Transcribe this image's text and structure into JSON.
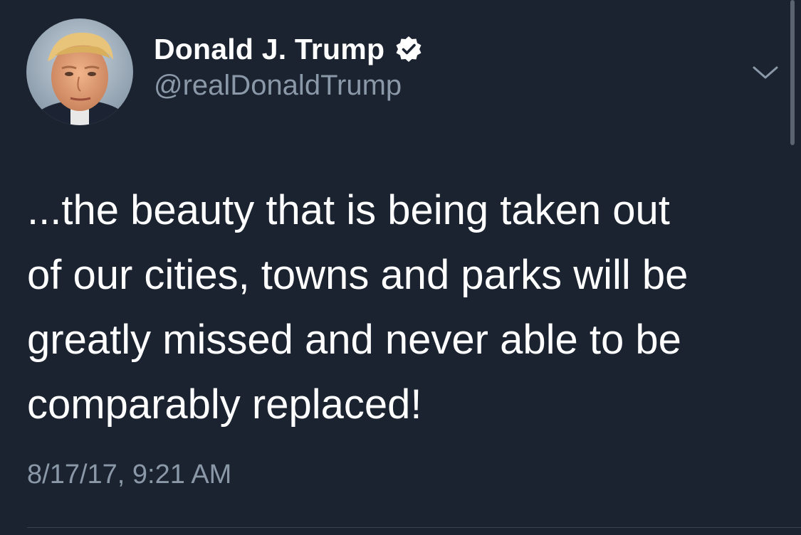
{
  "tweet": {
    "author": {
      "display_name": "Donald J. Trump",
      "handle": "@realDonaldTrump",
      "verified": true,
      "avatar_icon": "profile-photo"
    },
    "text": "...the beauty that is being taken out\nof our cities, towns and parks will be\ngreatly missed and never able to be\ncomparably replaced!",
    "timestamp": "8/17/17, 9:21 AM",
    "menu_icon": "chevron-down-icon"
  },
  "colors": {
    "background": "#1b2330",
    "primary_text": "#ffffff",
    "secondary_text": "#8a98a8",
    "divider": "#38444d"
  }
}
